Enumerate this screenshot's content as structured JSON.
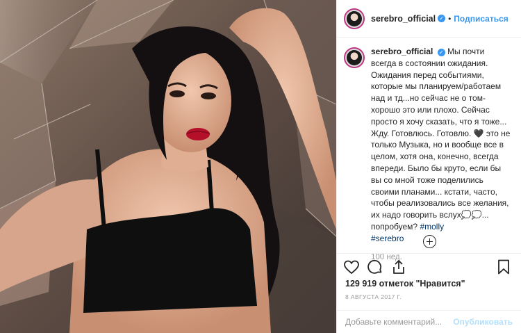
{
  "post": {
    "username": "serebro_official",
    "follow_label": "Подписаться",
    "dot": "•",
    "caption_text": "Мы почти всегда в состоянии ожидания. Ожидания перед событиями, которые мы планируем/работаем над и тд...но сейчас не о том- хорошо это или плохо. Сейчас просто я хочу сказать, что я тоже... Жду. Готовлюсь. Готовлю. 🖤 это не только Музыка, но и вообще все в целом, хотя она, конечно, всегда впереди. Было бы круто, если бы вы со мной тоже поделились своими планами... кстати, часто, чтобы реализовались все желания, их надо говорить вслух💭💭... попробуем? ",
    "hashtags": [
      "#molly",
      "#serebro"
    ],
    "time_ago": "100 нед.",
    "likes_text": "129 919 отметок \"Нравится\"",
    "date_text": "8 августа 2017 г.",
    "comment_placeholder": "Добавьте комментарий...",
    "publish_label": "Опубликовать"
  },
  "icons": {
    "verified": "verified-badge-icon",
    "like": "heart-icon",
    "comment": "comment-icon",
    "share": "share-icon",
    "save": "bookmark-icon",
    "more": "plus-circle-icon"
  },
  "colors": {
    "accent": "#3897f0",
    "hashtag": "#003569",
    "muted": "#999999",
    "publish_disabled": "#b2dffc",
    "border": "#efefef"
  }
}
